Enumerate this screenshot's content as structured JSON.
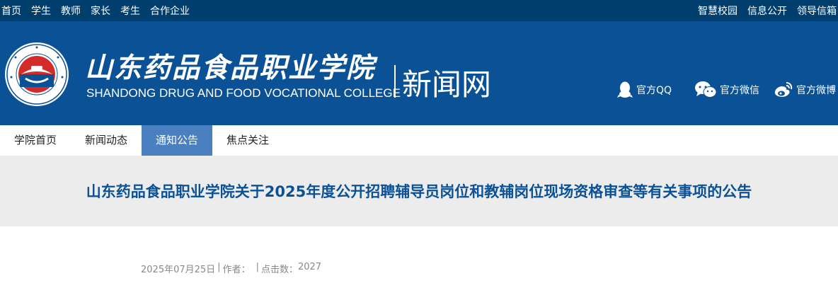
{
  "topbar": {
    "left_links": [
      "首页",
      "学生",
      "教师",
      "家长",
      "考生",
      "合作企业"
    ],
    "right_links": [
      "智慧校园",
      "信息公开",
      "领导信箱"
    ]
  },
  "header": {
    "school_name_cn": "山东药品食品职业学院",
    "school_name_en": "SHANDONG DRUG AND FOOD VOCATIONAL COLLEGE",
    "site_name": "新闻网",
    "social": {
      "qq": "官方QQ",
      "wechat": "官方微信",
      "weibo": "官方微博"
    },
    "colors": {
      "topbar": "#003e6e",
      "header": "#0b5196",
      "nav_active": "#4a7fc0",
      "logo_red": "#d32a2a"
    }
  },
  "nav": {
    "items": [
      "学院首页",
      "新闻动态",
      "通知公告",
      "焦点关注"
    ],
    "active_index": 2
  },
  "article": {
    "title": "山东药品食品职业学院关于2025年度公开招聘辅导员岗位和教辅岗位现场资格审查等有关事项的公告",
    "date": "2025年07月25日",
    "sep": "|",
    "author_label": "作者：",
    "clicks_label": "点击数：",
    "clicks": "2027"
  }
}
